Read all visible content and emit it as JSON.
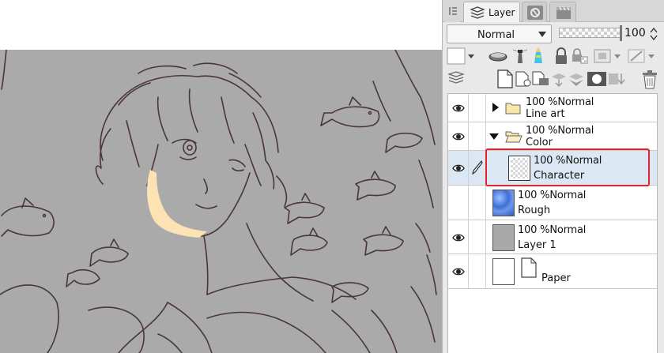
{
  "canvas": {
    "artwork": "character-lineart-with-fish",
    "colors": {
      "background": "#aaaaaa",
      "line": "#4a3538",
      "skin_fill": "#fde2b4"
    }
  },
  "panel": {
    "tabs": [
      {
        "name": "menu-tab",
        "label": ""
      },
      {
        "name": "layer-tab",
        "label": "Layer",
        "active": true
      },
      {
        "name": "navigator-tab",
        "label": ""
      },
      {
        "name": "timeline-tab",
        "label": ""
      }
    ],
    "blend_mode": "Normal",
    "opacity_value": "100",
    "opacity_level": 100
  },
  "layers": [
    {
      "name": "Line art",
      "opacity": "100 %",
      "blend": "Normal",
      "type": "folder",
      "expanded": false,
      "visible": true
    },
    {
      "name": "Color",
      "opacity": "100 %",
      "blend": "Normal",
      "type": "folder",
      "expanded": true,
      "visible": true
    },
    {
      "name": "Character",
      "opacity": "100 %",
      "blend": "Normal",
      "type": "raster",
      "selected": true,
      "visible": true,
      "editing": true
    },
    {
      "name": "Rough",
      "opacity": "100 %",
      "blend": "Normal",
      "type": "raster",
      "visible": false
    },
    {
      "name": "Layer 1",
      "opacity": "100 %",
      "blend": "Normal",
      "type": "raster",
      "visible": true
    },
    {
      "name": "Paper",
      "opacity": "",
      "blend": "",
      "type": "paper",
      "visible": true
    }
  ],
  "colors": {
    "selection_highlight": "#dbe8f3",
    "selection_border": "#e0252a",
    "panel_bg": "#e9e9e9"
  }
}
